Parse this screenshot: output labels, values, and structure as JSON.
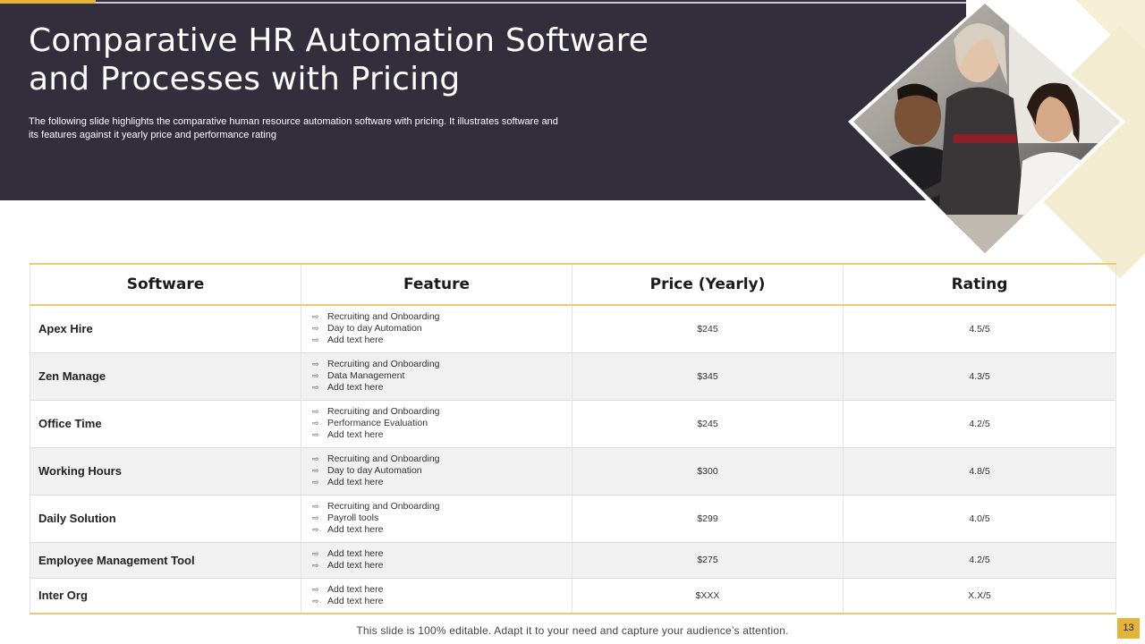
{
  "slide": {
    "title": "Comparative HR Automation Software and Processes with Pricing",
    "subtitle": "The following slide highlights the comparative human resource automation software with pricing. It illustrates software and its features against it yearly  price and performance rating",
    "footer": "This slide is 100% editable. Adapt it to your need and capture your audience’s attention.",
    "page_number": "13"
  },
  "colors": {
    "header_bg": "#332e3c",
    "accent_gold": "#e2b53a",
    "row_alt": "#f1f1f1"
  },
  "table": {
    "headers": [
      "Software",
      "Feature",
      "Price (Yearly)",
      "Rating"
    ],
    "rows": [
      {
        "software": "Apex Hire",
        "features": [
          "Recruiting and Onboarding",
          "Day to day Automation",
          "Add text here"
        ],
        "price": "$245",
        "rating": "4.5/5"
      },
      {
        "software": "Zen Manage",
        "features": [
          "Recruiting and Onboarding",
          "Data Management",
          "Add text here"
        ],
        "price": "$345",
        "rating": "4.3/5"
      },
      {
        "software": "Office Time",
        "features": [
          "Recruiting and Onboarding",
          "Performance Evaluation",
          "Add text here"
        ],
        "price": "$245",
        "rating": "4.2/5"
      },
      {
        "software": "Working Hours",
        "features": [
          "Recruiting and Onboarding",
          "Day to day Automation",
          "Add text here"
        ],
        "price": "$300",
        "rating": "4.8/5"
      },
      {
        "software": "Daily Solution",
        "features": [
          "Recruiting and Onboarding",
          "Payroll tools",
          "Add text here"
        ],
        "price": "$299",
        "rating": "4.0/5"
      },
      {
        "software": "Employee Management Tool",
        "features": [
          "Add text here",
          "Add text here"
        ],
        "price": "$275",
        "rating": "4.2/5"
      },
      {
        "software": "Inter Org",
        "features": [
          "Add text here",
          "Add text here"
        ],
        "price": "$XXX",
        "rating": "X.X/5"
      }
    ]
  },
  "icons": {
    "feature_bullet": "arrow-right-icon",
    "photo": "team-meeting-photo"
  }
}
